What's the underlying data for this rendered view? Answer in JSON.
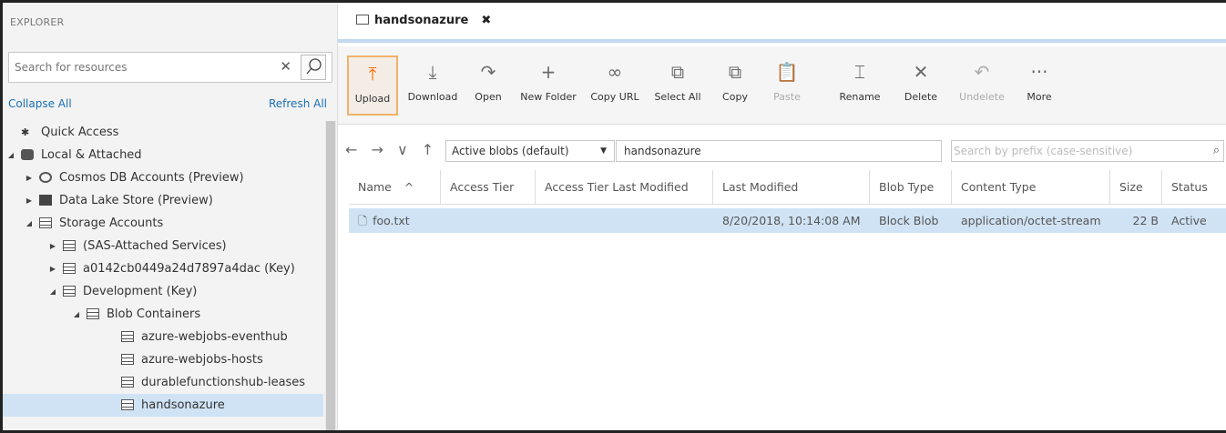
{
  "explorer": {
    "header": "EXPLORER",
    "search_placeholder": "Search for resources",
    "collapse_all": "Collapse All",
    "refresh_all": "Refresh All",
    "tree": [
      {
        "label": "Quick Access",
        "level": 0,
        "twisty": "",
        "icon": "quick-access-icon"
      },
      {
        "label": "Local & Attached",
        "level": 0,
        "twisty": "expanded",
        "icon": "local-attached-icon"
      },
      {
        "label": "Cosmos DB Accounts (Preview)",
        "level": 1,
        "twisty": "collapsed",
        "icon": "cosmos-db-icon"
      },
      {
        "label": "Data Lake Store (Preview)",
        "level": 1,
        "twisty": "collapsed",
        "icon": "data-lake-icon"
      },
      {
        "label": "Storage Accounts",
        "level": 1,
        "twisty": "expanded",
        "icon": "storage-accounts-icon"
      },
      {
        "label": "(SAS-Attached Services)",
        "level": 2,
        "twisty": "collapsed",
        "icon": "storage-account-icon"
      },
      {
        "label": "a0142cb0449a24d7897a4dac (Key)",
        "level": 2,
        "twisty": "collapsed",
        "icon": "storage-account-icon"
      },
      {
        "label": "Development (Key)",
        "level": 2,
        "twisty": "expanded",
        "icon": "storage-account-icon"
      },
      {
        "label": "Blob Containers",
        "level": 3,
        "twisty": "expanded",
        "icon": "blob-containers-icon"
      },
      {
        "label": "azure-webjobs-eventhub",
        "level": 4,
        "twisty": "",
        "icon": "container-icon"
      },
      {
        "label": "azure-webjobs-hosts",
        "level": 4,
        "twisty": "",
        "icon": "container-icon"
      },
      {
        "label": "durablefunctionshub-leases",
        "level": 4,
        "twisty": "",
        "icon": "container-icon"
      },
      {
        "label": "handsonazure",
        "level": 4,
        "twisty": "",
        "icon": "container-icon",
        "selected": true
      }
    ]
  },
  "tab": {
    "title": "handsonazure",
    "close": "✖"
  },
  "toolbar": {
    "buttons": [
      {
        "label": "Upload",
        "glyph": "⤒",
        "name": "upload-button",
        "icon": "upload-icon",
        "state": "active"
      },
      {
        "label": "Download",
        "glyph": "⤓",
        "name": "download-button",
        "icon": "download-icon",
        "state": "normal"
      },
      {
        "label": "Open",
        "glyph": "↷",
        "name": "open-button",
        "icon": "open-icon",
        "state": "normal"
      },
      {
        "label": "New Folder",
        "glyph": "+",
        "name": "new-folder-button",
        "icon": "plus-icon",
        "state": "normal"
      },
      {
        "label": "Copy URL",
        "glyph": "∞",
        "name": "copy-url-button",
        "icon": "link-icon",
        "state": "normal"
      },
      {
        "label": "Select All",
        "glyph": "⧉",
        "name": "select-all-button",
        "icon": "select-all-icon",
        "state": "normal"
      },
      {
        "label": "Copy",
        "glyph": "⧉",
        "name": "copy-button",
        "icon": "copy-icon",
        "state": "normal"
      },
      {
        "label": "Paste",
        "glyph": "📋",
        "name": "paste-button",
        "icon": "paste-icon",
        "state": "disabled"
      },
      {
        "label": "Rename",
        "glyph": "⌶",
        "name": "rename-button",
        "icon": "rename-icon",
        "state": "normal"
      },
      {
        "label": "Delete",
        "glyph": "✕",
        "name": "delete-button",
        "icon": "delete-icon",
        "state": "normal"
      },
      {
        "label": "Undelete",
        "glyph": "↶",
        "name": "undelete-button",
        "icon": "undelete-icon",
        "state": "disabled"
      },
      {
        "label": "More",
        "glyph": "···",
        "name": "more-button",
        "icon": "more-icon",
        "state": "normal"
      }
    ]
  },
  "nav": {
    "arrows": "← → ∨ ↑",
    "view_selected": "Active blobs (default)",
    "path": "handsonazure",
    "prefix_placeholder": "Search by prefix (case-sensitive)"
  },
  "grid": {
    "columns": [
      "Name",
      "Access Tier",
      "Access Tier Last Modified",
      "Last Modified",
      "Blob Type",
      "Content Type",
      "Size",
      "Status"
    ],
    "sort_indicator": "^",
    "rows": [
      {
        "name": "foo.txt",
        "access_tier": "",
        "access_tier_last_modified": "",
        "last_modified": "8/20/2018, 10:14:08 AM",
        "blob_type": "Block Blob",
        "content_type": "application/octet-stream",
        "size": "22 B",
        "status": "Active"
      }
    ]
  },
  "colors": {
    "accent": "#1a6fb5",
    "selected": "#cfe3f5",
    "upload_highlight": "#f0b26a"
  }
}
